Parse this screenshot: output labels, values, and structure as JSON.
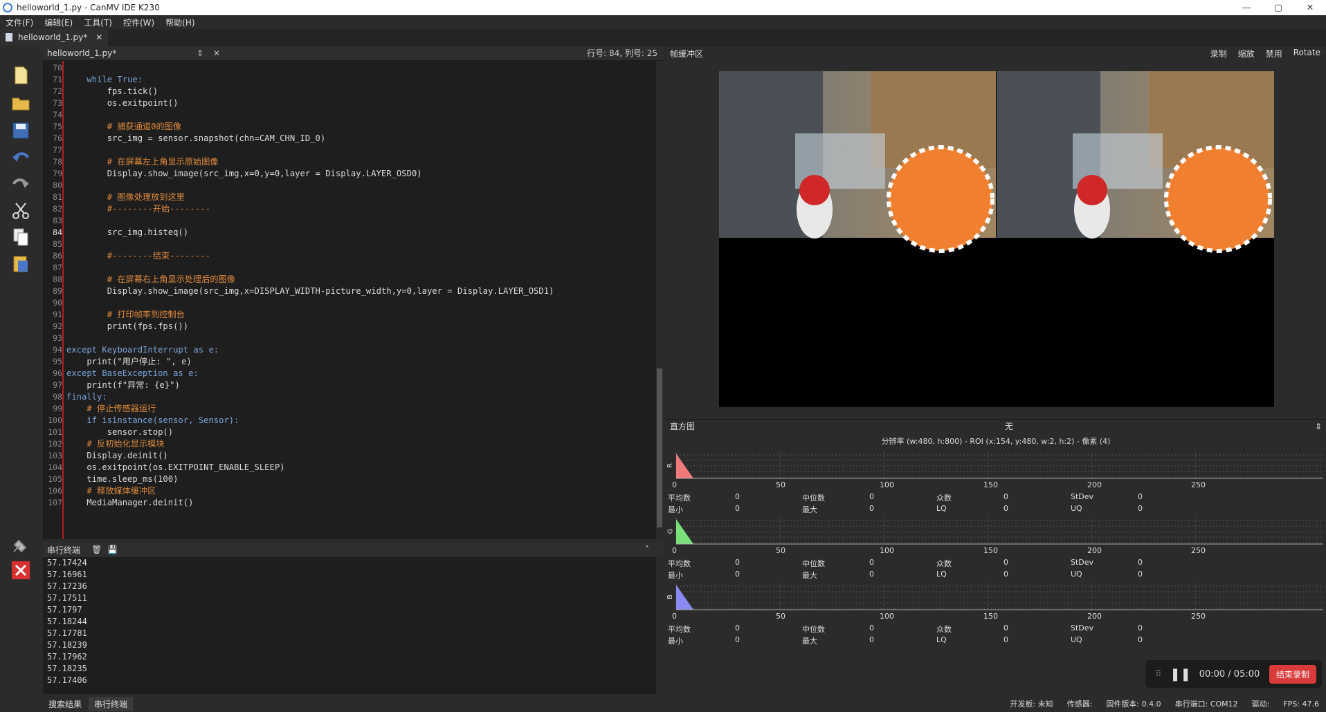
{
  "window": {
    "title": "helloworld_1.py - CanMV IDE K230",
    "min": "—",
    "max": "▢",
    "close": "✕"
  },
  "menu": [
    "文件(F)",
    "编辑(E)",
    "工具(T)",
    "控件(W)",
    "帮助(H)"
  ],
  "tab": {
    "label": "helloworld_1.py*",
    "close": "✕"
  },
  "editor_header": {
    "file": "helloworld_1.py*",
    "cursor": "行号: 84, 列号: 25"
  },
  "code_lines": [
    {
      "n": "70",
      "t": ""
    },
    {
      "n": "71",
      "t": "    while True:"
    },
    {
      "n": "72",
      "t": "        fps.tick()"
    },
    {
      "n": "73",
      "t": "        os.exitpoint()"
    },
    {
      "n": "74",
      "t": ""
    },
    {
      "n": "75",
      "t": "        # 捕获通道0的图像"
    },
    {
      "n": "76",
      "t": "        src_img = sensor.snapshot(chn=CAM_CHN_ID_0)"
    },
    {
      "n": "77",
      "t": ""
    },
    {
      "n": "78",
      "t": "        # 在屏幕左上角显示原始图像"
    },
    {
      "n": "79",
      "t": "        Display.show_image(src_img,x=0,y=0,layer = Display.LAYER_OSD0)"
    },
    {
      "n": "80",
      "t": ""
    },
    {
      "n": "81",
      "t": "        # 图像处理放到这里"
    },
    {
      "n": "82",
      "t": "        #--------开始--------"
    },
    {
      "n": "83",
      "t": ""
    },
    {
      "n": "84",
      "t": "        src_img.histeq()"
    },
    {
      "n": "85",
      "t": ""
    },
    {
      "n": "86",
      "t": "        #--------结束--------"
    },
    {
      "n": "87",
      "t": ""
    },
    {
      "n": "88",
      "t": "        # 在屏幕右上角显示处理后的图像"
    },
    {
      "n": "89",
      "t": "        Display.show_image(src_img,x=DISPLAY_WIDTH-picture_width,y=0,layer = Display.LAYER_OSD1)"
    },
    {
      "n": "90",
      "t": ""
    },
    {
      "n": "91",
      "t": "        # 打印帧率到控制台"
    },
    {
      "n": "92",
      "t": "        print(fps.fps())"
    },
    {
      "n": "93",
      "t": ""
    },
    {
      "n": "94",
      "t": "except KeyboardInterrupt as e:"
    },
    {
      "n": "95",
      "t": "    print(\"用户停止: \", e)"
    },
    {
      "n": "96",
      "t": "except BaseException as e:"
    },
    {
      "n": "97",
      "t": "    print(f\"异常: {e}\")"
    },
    {
      "n": "98",
      "t": "finally:"
    },
    {
      "n": "99",
      "t": "    # 停止传感器运行"
    },
    {
      "n": "100",
      "t": "    if isinstance(sensor, Sensor):"
    },
    {
      "n": "101",
      "t": "        sensor.stop()"
    },
    {
      "n": "102",
      "t": "    # 反初始化显示模块"
    },
    {
      "n": "103",
      "t": "    Display.deinit()"
    },
    {
      "n": "104",
      "t": "    os.exitpoint(os.EXITPOINT_ENABLE_SLEEP)"
    },
    {
      "n": "105",
      "t": "    time.sleep_ms(100)"
    },
    {
      "n": "106",
      "t": "    # 释放媒体缓冲区"
    },
    {
      "n": "107",
      "t": "    MediaManager.deinit()"
    }
  ],
  "terminal": {
    "title": "串行终端",
    "lines": [
      "57.17424",
      "57.16961",
      "57.17236",
      "57.17511",
      "57.1797",
      "57.18244",
      "57.17781",
      "57.18239",
      "57.17962",
      "57.18235",
      "57.17406"
    ]
  },
  "bottom_tabs": [
    "搜索结果",
    "串行终端"
  ],
  "framebuffer": {
    "title": "帧缓冲区",
    "buttons": [
      "录制",
      "缩放",
      "禁用",
      "Rotate"
    ]
  },
  "histogram": {
    "title": "直方图",
    "mode": "无",
    "resolution": "分辨率 (w:480, h:800) - ROI (x:154, y:480, w:2, h:2) - 像素 (4)",
    "ticks": [
      "0",
      "50",
      "100",
      "150",
      "200",
      "250"
    ],
    "channels": [
      {
        "name": "R",
        "color": "#f07a7a"
      },
      {
        "name": "G",
        "color": "#7ae07a"
      },
      {
        "name": "B",
        "color": "#8a8af5"
      }
    ],
    "stats_labels": [
      "平均数",
      "中位数",
      "众数",
      "StDev"
    ],
    "stats_labels2": [
      "最小",
      "最大",
      "LQ",
      "UQ"
    ],
    "value": "0"
  },
  "recorder": {
    "time": "00:00 / 05:00",
    "stop": "结束录制"
  },
  "status": [
    "开发板: 未知",
    "传感器:",
    "固件版本: 0.4.0",
    "串行端口: COM12",
    "驱动:",
    "FPS: 47.6"
  ]
}
